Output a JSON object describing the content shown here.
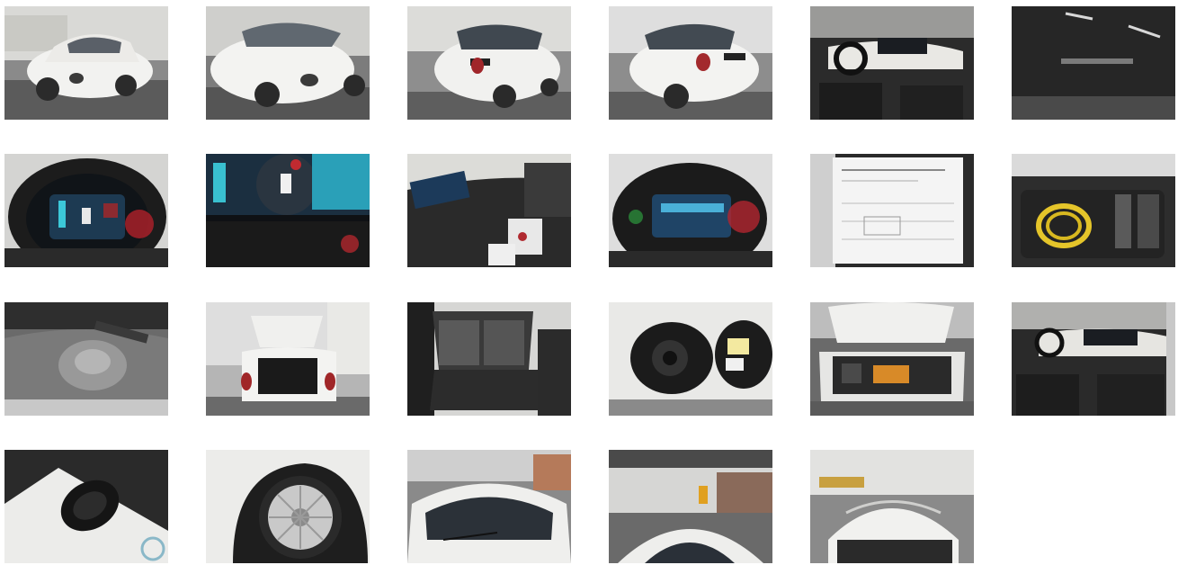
{
  "gallery": {
    "photos": [
      {
        "subject": "car-front-left",
        "tone": "#bfbfbf"
      },
      {
        "subject": "car-front-right",
        "tone": "#b9b9b9"
      },
      {
        "subject": "car-rear-right",
        "tone": "#c4c4c4"
      },
      {
        "subject": "car-rear-left",
        "tone": "#c8c8c8"
      },
      {
        "subject": "interior-dashboard",
        "tone": "#3a3a3a"
      },
      {
        "subject": "window-glass",
        "tone": "#1e1e1e"
      },
      {
        "subject": "instrument-cluster",
        "tone": "#2a2a2a"
      },
      {
        "subject": "digital-display-closeup",
        "tone": "#141414"
      },
      {
        "subject": "infotainment-screen",
        "tone": "#2c2c2c"
      },
      {
        "subject": "instrument-cluster-lit",
        "tone": "#303030"
      },
      {
        "subject": "paper-documents",
        "tone": "#e6e6e6"
      },
      {
        "subject": "trunk-charging-cable",
        "tone": "#3b3b3b"
      },
      {
        "subject": "spare-wheel-well",
        "tone": "#8d8d8d"
      },
      {
        "subject": "open-trunk",
        "tone": "#bdbdbd"
      },
      {
        "subject": "rear-seats",
        "tone": "#4a4a4a"
      },
      {
        "subject": "charging-port",
        "tone": "#e0e0e0"
      },
      {
        "subject": "open-hood",
        "tone": "#6e6e6e"
      },
      {
        "subject": "interior-seats",
        "tone": "#2f2f2f"
      },
      {
        "subject": "key-fob",
        "tone": "#e2e2e2"
      },
      {
        "subject": "wheel-rim",
        "tone": "#dcdcdc"
      },
      {
        "subject": "windshield-front",
        "tone": "#8f8f8f"
      },
      {
        "subject": "roof-view",
        "tone": "#7a7a7a"
      },
      {
        "subject": "roof-rear-view",
        "tone": "#9a9a9a"
      }
    ]
  }
}
